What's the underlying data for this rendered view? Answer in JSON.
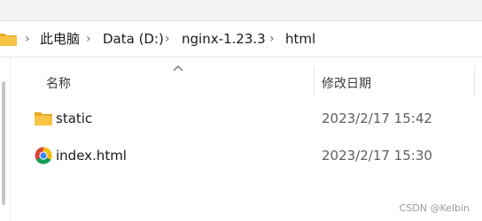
{
  "breadcrumb": {
    "items": [
      "此电脑",
      "Data (D:)",
      "nginx-1.23.3",
      "html"
    ],
    "separator": "›"
  },
  "columns": {
    "name": "名称",
    "date_modified": "修改日期"
  },
  "files": [
    {
      "name": "static",
      "date_modified": "2023/2/17 15:42",
      "icon": "folder-icon"
    },
    {
      "name": "index.html",
      "date_modified": "2023/2/17 15:30",
      "icon": "chrome-html-icon"
    }
  ],
  "watermark": "CSDN @Kelbin",
  "colors": {
    "folder": "#f8c443",
    "chrome_red": "#db4437",
    "chrome_yellow": "#f4c20d",
    "chrome_green": "#0f9d58",
    "chrome_blue": "#4285f4"
  }
}
